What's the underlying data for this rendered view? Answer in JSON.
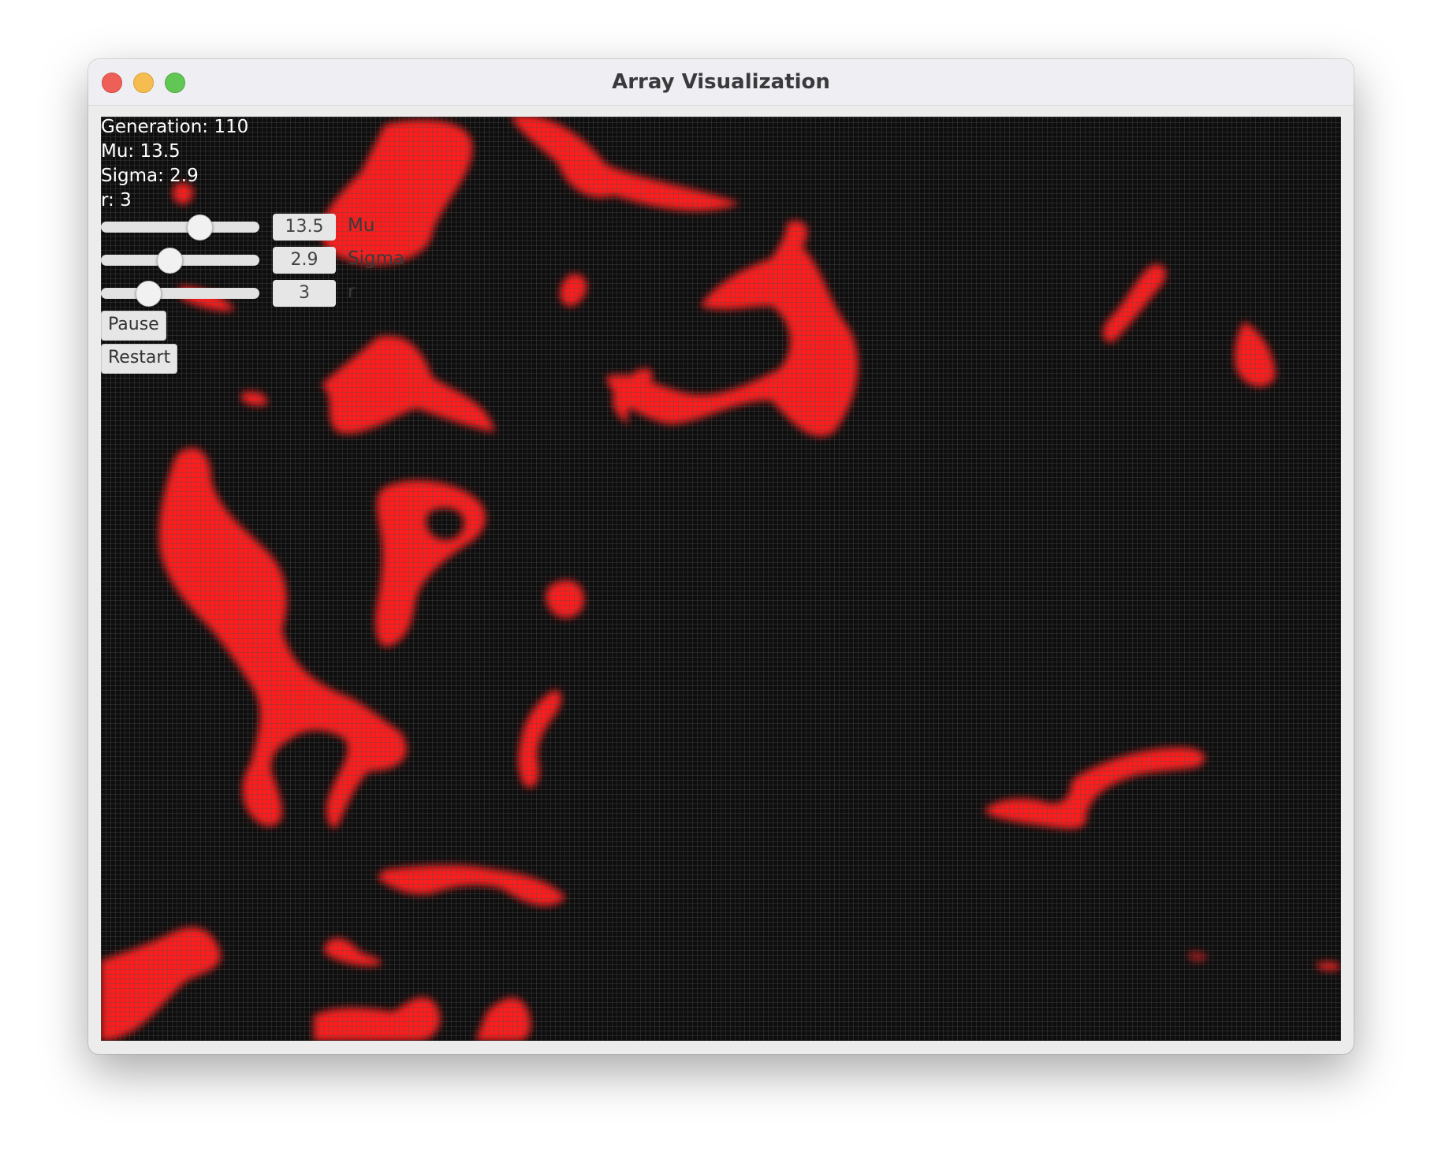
{
  "window": {
    "title": "Array Visualization"
  },
  "stats": {
    "generation": "Generation: 110",
    "mu": "Mu: 13.5",
    "sigma": "Sigma: 2.9",
    "r": "r: 3"
  },
  "controls": {
    "mu": {
      "value": "13.5",
      "label": "Mu",
      "fraction": 0.65
    },
    "sigma": {
      "value": "2.9",
      "label": "Sigma",
      "fraction": 0.42
    },
    "r": {
      "value": "3",
      "label": "r",
      "fraction": 0.26
    }
  },
  "buttons": {
    "pause": "Pause",
    "restart": "Restart"
  },
  "colors": {
    "cell": "#ff1a1a",
    "background": "#0e0e0e"
  }
}
